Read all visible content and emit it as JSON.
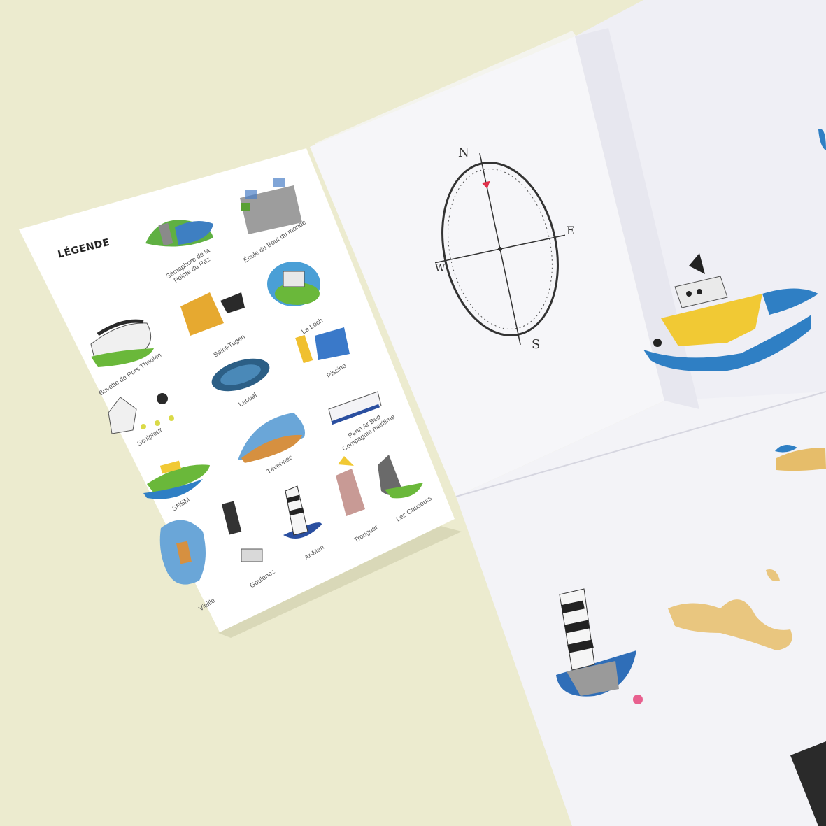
{
  "legend": {
    "title": "LÉGENDE",
    "items": [
      {
        "label": "Sémaphore de la",
        "label2": "Pointe du Raz"
      },
      {
        "label": "École du Bout du monde"
      },
      {
        "label": "Le Loch"
      },
      {
        "label": "Saint-Tugen"
      },
      {
        "label": "Buvette de Pors Theolen"
      },
      {
        "label": "Piscine"
      },
      {
        "label": "Laoual"
      },
      {
        "label": "Sculpteur"
      },
      {
        "label": "Penn Ar Bed",
        "label2": "Compagnie maritime"
      },
      {
        "label": "Tévennec"
      },
      {
        "label": "SNSM"
      },
      {
        "label": "Les Causeurs"
      },
      {
        "label": "Trouguer"
      },
      {
        "label": "Ar-Men"
      },
      {
        "label": "Goulenez"
      },
      {
        "label": "Vieille"
      }
    ]
  },
  "compass": {
    "north": "N",
    "east": "E",
    "south": "S",
    "west": "W"
  },
  "colors": {
    "background": "#ecebcf",
    "paper": "#fbfbfd",
    "sea_blue": "#2f7fc4",
    "boat_yellow": "#f1c934",
    "sand": "#e6bd6a"
  }
}
